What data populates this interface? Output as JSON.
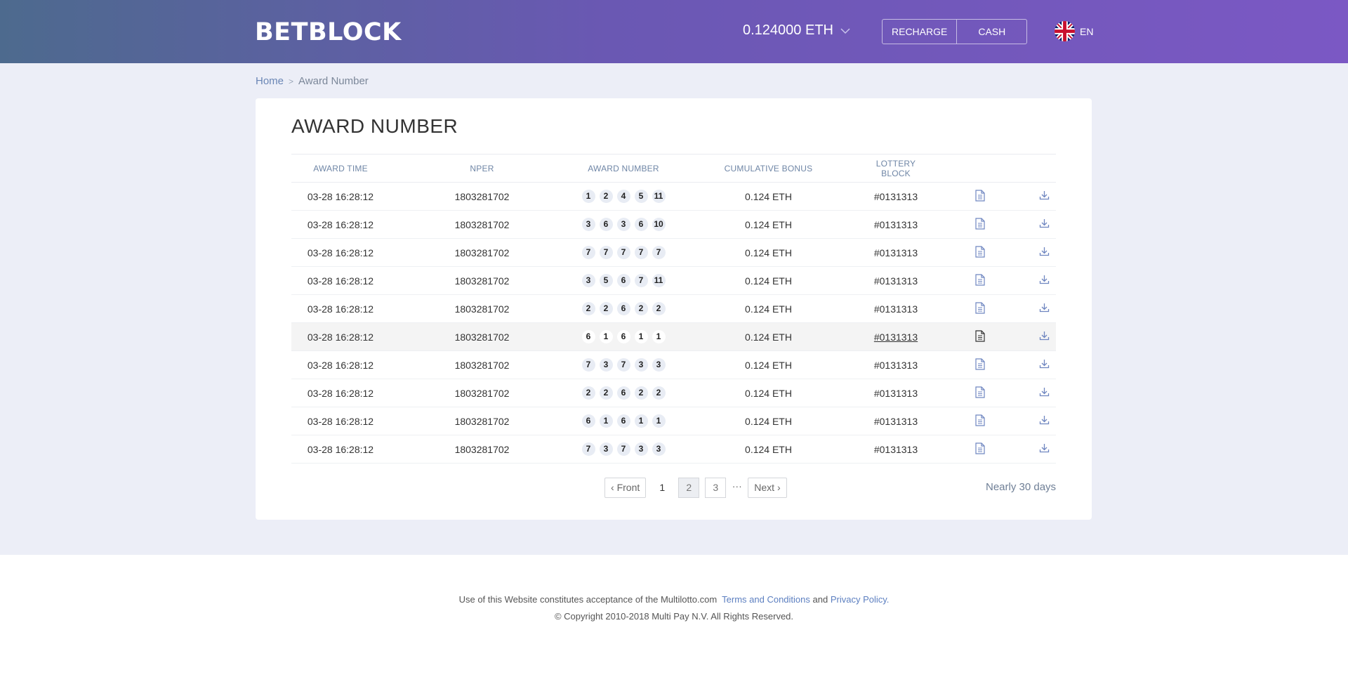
{
  "header": {
    "logo": "BETBLOCK",
    "balance": "0.124000 ETH",
    "recharge_label": "RECHARGE",
    "cash_label": "CASH",
    "language": "EN"
  },
  "breadcrumb": {
    "home": "Home",
    "separator": ">",
    "current": "Award Number"
  },
  "page_title": "AWARD NUMBER",
  "table": {
    "columns": [
      "AWARD TIME",
      "NPER",
      "AWARD NUMBER",
      "CUMULATIVE BONUS",
      "LOTTERY BLOCK"
    ],
    "rows": [
      {
        "time": "03-28  16:28:12",
        "nper": "1803281702",
        "numbers": [
          "1",
          "2",
          "4",
          "5",
          "11"
        ],
        "bonus": "0.124 ETH",
        "block": "#0131313"
      },
      {
        "time": "03-28  16:28:12",
        "nper": "1803281702",
        "numbers": [
          "3",
          "6",
          "3",
          "6",
          "10"
        ],
        "bonus": "0.124 ETH",
        "block": "#0131313"
      },
      {
        "time": "03-28  16:28:12",
        "nper": "1803281702",
        "numbers": [
          "7",
          "7",
          "7",
          "7",
          "7"
        ],
        "bonus": "0.124 ETH",
        "block": "#0131313"
      },
      {
        "time": "03-28  16:28:12",
        "nper": "1803281702",
        "numbers": [
          "3",
          "5",
          "6",
          "7",
          "11"
        ],
        "bonus": "0.124 ETH",
        "block": "#0131313"
      },
      {
        "time": "03-28  16:28:12",
        "nper": "1803281702",
        "numbers": [
          "2",
          "2",
          "6",
          "2",
          "2"
        ],
        "bonus": "0.124 ETH",
        "block": "#0131313"
      },
      {
        "time": "03-28  16:28:12",
        "nper": "1803281702",
        "numbers": [
          "6",
          "1",
          "6",
          "1",
          "1"
        ],
        "bonus": "0.124 ETH",
        "block": "#0131313",
        "highlighted": true
      },
      {
        "time": "03-28  16:28:12",
        "nper": "1803281702",
        "numbers": [
          "7",
          "3",
          "7",
          "3",
          "3"
        ],
        "bonus": "0.124 ETH",
        "block": "#0131313"
      },
      {
        "time": "03-28  16:28:12",
        "nper": "1803281702",
        "numbers": [
          "2",
          "2",
          "6",
          "2",
          "2"
        ],
        "bonus": "0.124 ETH",
        "block": "#0131313"
      },
      {
        "time": "03-28  16:28:12",
        "nper": "1803281702",
        "numbers": [
          "6",
          "1",
          "6",
          "1",
          "1"
        ],
        "bonus": "0.124 ETH",
        "block": "#0131313"
      },
      {
        "time": "03-28  16:28:12",
        "nper": "1803281702",
        "numbers": [
          "7",
          "3",
          "7",
          "3",
          "3"
        ],
        "bonus": "0.124 ETH",
        "block": "#0131313"
      }
    ],
    "row_icons": [
      "document-icon",
      "download-icon"
    ]
  },
  "pagination": {
    "front": "Front",
    "pages": [
      "1",
      "2",
      "3"
    ],
    "current_page": "2",
    "ellipsis": "···",
    "next": "Next",
    "note": "Nearly 30 days"
  },
  "footer": {
    "line1_prefix": "Use of this Website constitutes acceptance of the Multilotto.com",
    "terms": "Terms and Conditions",
    "and": "and",
    "privacy": "Privacy Policy.",
    "copyright": "© Copyright 2010-2018 Multi Pay N.V. All Rights Reserved."
  },
  "colors": {
    "header_gradient_start": "#4d6a8e",
    "header_gradient_end": "#7b58c4",
    "page_background": "#eceef7",
    "accent_link": "#5c7fc0",
    "icon_blue": "#6f86c0"
  }
}
